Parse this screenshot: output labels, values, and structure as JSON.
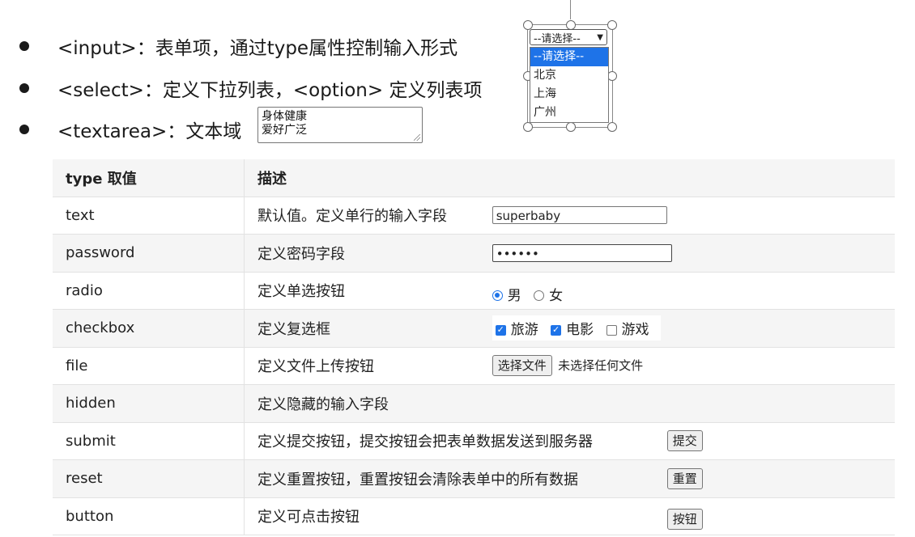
{
  "bullets": [
    "<input>：表单项，通过type属性控制输入形式",
    "<select>：定义下拉列表，<option> 定义列表项",
    "<textarea>：文本域"
  ],
  "textarea_demo": {
    "line1": "身体健康",
    "line2": "爱好广泛"
  },
  "select_demo": {
    "selected": "--请选择--",
    "options": [
      "--请选择--",
      "北京",
      "上海",
      "广州"
    ]
  },
  "table": {
    "headers": [
      "type 取值",
      "描述"
    ],
    "rows": [
      {
        "type": "text",
        "desc": "默认值。定义单行的输入字段",
        "demo_value": "superbaby"
      },
      {
        "type": "password",
        "desc": "定义密码字段",
        "demo_value": "••••••"
      },
      {
        "type": "radio",
        "desc": "定义单选按钮",
        "options": [
          "男",
          "女"
        ]
      },
      {
        "type": "checkbox",
        "desc": "定义复选框",
        "options": [
          "旅游",
          "电影",
          "游戏"
        ]
      },
      {
        "type": "file",
        "desc": "定义文件上传按钮",
        "button": "选择文件",
        "status": "未选择任何文件"
      },
      {
        "type": "hidden",
        "desc": "定义隐藏的输入字段"
      },
      {
        "type": "submit",
        "desc": "定义提交按钮，提交按钮会把表单数据发送到服务器",
        "button": "提交"
      },
      {
        "type": "reset",
        "desc": "定义重置按钮，重置按钮会清除表单中的所有数据",
        "button": "重置"
      },
      {
        "type": "button",
        "desc": "定义可点击按钮",
        "button": "按钮"
      }
    ]
  },
  "colors": {
    "accent": "#1e73e8",
    "row_alt": "#f5f5f5"
  }
}
